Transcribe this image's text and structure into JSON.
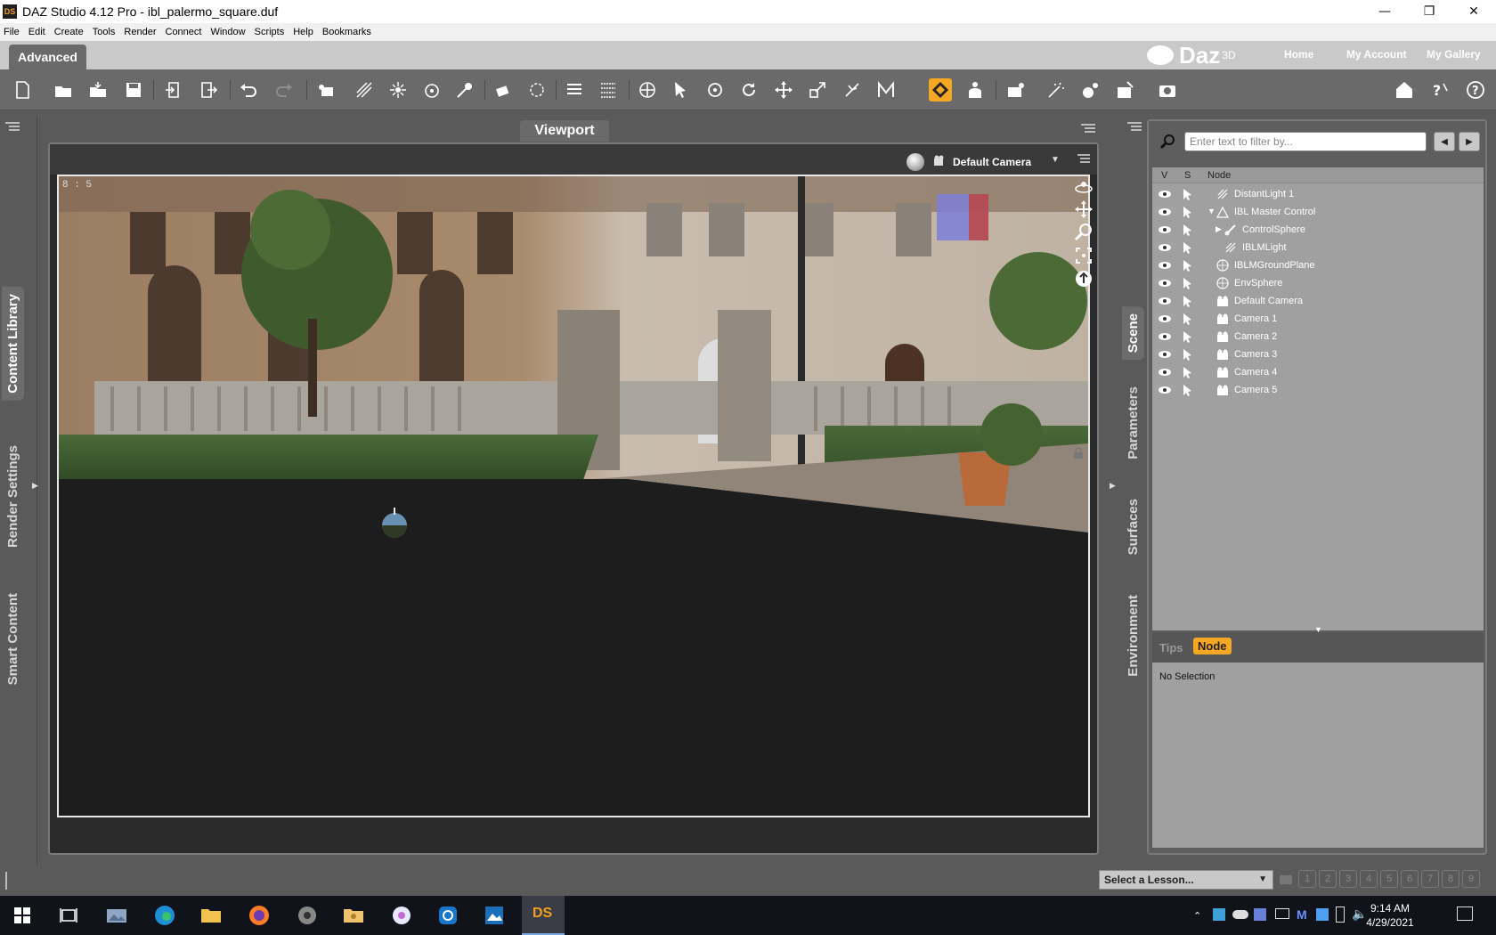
{
  "window": {
    "logo_text": "DS",
    "title": "DAZ Studio 4.12 Pro - ibl_palermo_square.duf",
    "minimize": "—",
    "restore": "❐",
    "close": "✕"
  },
  "menu": [
    "File",
    "Edit",
    "Create",
    "Tools",
    "Render",
    "Connect",
    "Window",
    "Scripts",
    "Help",
    "Bookmarks"
  ],
  "header": {
    "layout_tab": "Advanced",
    "brand": "Daz",
    "brand_sup": "3D",
    "links": [
      "Home",
      "My Account",
      "My Gallery"
    ]
  },
  "left_tabs": [
    "Content Library",
    "Render Settings",
    "Smart Content"
  ],
  "viewport": {
    "title": "Viewport",
    "camera": "Default Camera",
    "aspect": "8 : 5"
  },
  "right_tabs": [
    "Scene",
    "Parameters",
    "Surfaces",
    "Environment"
  ],
  "scene_panel": {
    "filter_placeholder": "Enter text to filter by...",
    "columns": [
      "V",
      "S",
      "Node"
    ],
    "nodes": [
      {
        "name": "DistantLight 1",
        "indent": 0,
        "icon": "light-icon",
        "expander": ""
      },
      {
        "name": "IBL Master Control",
        "indent": 0,
        "icon": "node-icon",
        "expander": "▼"
      },
      {
        "name": "ControlSphere",
        "indent": 1,
        "icon": "bone-icon",
        "expander": "▶"
      },
      {
        "name": "IBLMLight",
        "indent": 1,
        "icon": "light-icon",
        "expander": ""
      },
      {
        "name": "IBLMGroundPlane",
        "indent": 0,
        "icon": "primitive-icon",
        "expander": ""
      },
      {
        "name": "EnvSphere",
        "indent": 0,
        "icon": "primitive-icon",
        "expander": ""
      },
      {
        "name": "Default Camera",
        "indent": 0,
        "icon": "camera-icon",
        "expander": ""
      },
      {
        "name": "Camera 1",
        "indent": 0,
        "icon": "camera-icon",
        "expander": ""
      },
      {
        "name": "Camera 2",
        "indent": 0,
        "icon": "camera-icon",
        "expander": ""
      },
      {
        "name": "Camera 3",
        "indent": 0,
        "icon": "camera-icon",
        "expander": ""
      },
      {
        "name": "Camera 4",
        "indent": 0,
        "icon": "camera-icon",
        "expander": ""
      },
      {
        "name": "Camera 5",
        "indent": 0,
        "icon": "camera-icon",
        "expander": ""
      }
    ],
    "info_tabs": [
      "Tips",
      "Node"
    ],
    "active_info_tab": "Node",
    "info_text": "No Selection"
  },
  "status": {
    "lesson_placeholder": "Select a Lesson...",
    "lesson_steps": [
      "1",
      "2",
      "3",
      "4",
      "5",
      "6",
      "7",
      "8",
      "9"
    ]
  },
  "taskbar": {
    "time": "9:14 AM",
    "date": "4/29/2021",
    "active_app": "DS"
  },
  "colors": {
    "accent": "#f5a623",
    "toolbar": "#6a6a6a",
    "panel_bg": "#a0a0a0"
  }
}
